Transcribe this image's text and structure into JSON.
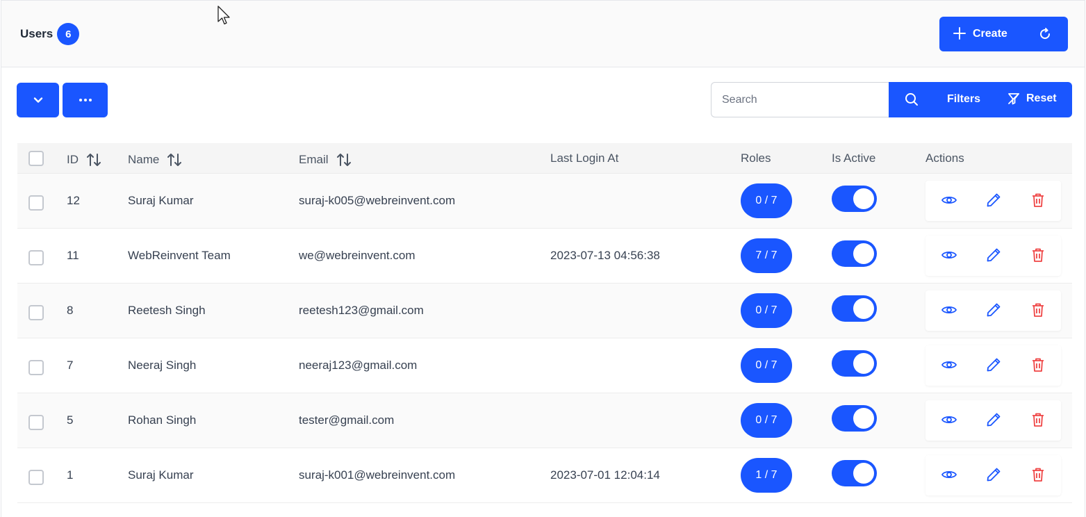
{
  "header": {
    "title": "Users",
    "count": "6",
    "create_label": "Create"
  },
  "toolbar": {
    "search_placeholder": "Search",
    "filters_label": "Filters",
    "reset_label": "Reset"
  },
  "table": {
    "columns": {
      "id": "ID",
      "name": "Name",
      "email": "Email",
      "last_login": "Last Login At",
      "roles": "Roles",
      "is_active": "Is Active",
      "actions": "Actions"
    },
    "rows": [
      {
        "id": "12",
        "name": "Suraj Kumar",
        "email": "suraj-k005@webreinvent.com",
        "last_login": "",
        "roles": "0 / 7",
        "active": true
      },
      {
        "id": "11",
        "name": "WebReinvent Team",
        "email": "we@webreinvent.com",
        "last_login": "2023-07-13 04:56:38",
        "roles": "7 / 7",
        "active": true
      },
      {
        "id": "8",
        "name": "Reetesh Singh",
        "email": "reetesh123@gmail.com",
        "last_login": "",
        "roles": "0 / 7",
        "active": true
      },
      {
        "id": "7",
        "name": "Neeraj Singh",
        "email": "neeraj123@gmail.com",
        "last_login": "",
        "roles": "0 / 7",
        "active": true
      },
      {
        "id": "5",
        "name": "Rohan Singh",
        "email": "tester@gmail.com",
        "last_login": "",
        "roles": "0 / 7",
        "active": true
      },
      {
        "id": "1",
        "name": "Suraj Kumar",
        "email": "suraj-k001@webreinvent.com",
        "last_login": "2023-07-01 12:04:14",
        "roles": "1 / 7",
        "active": true
      }
    ]
  },
  "icons": {
    "view": "eye-icon",
    "edit": "pencil-icon",
    "delete": "trash-icon"
  },
  "colors": {
    "primary": "#1a56ff",
    "danger": "#ef4444"
  }
}
